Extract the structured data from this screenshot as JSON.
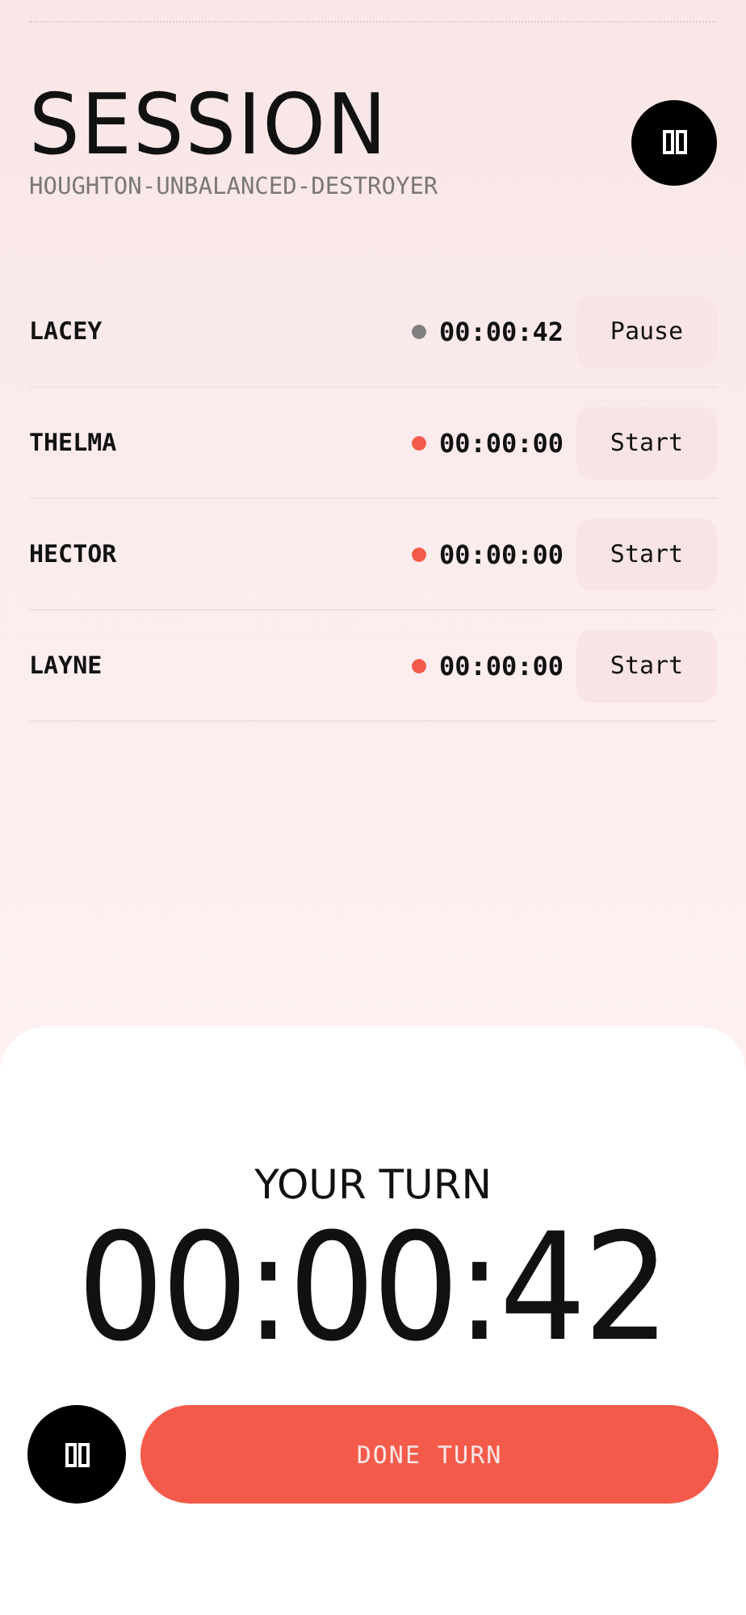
{
  "header": {
    "title": "SESSION",
    "subtitle": "HOUGHTON-UNBALANCED-DESTROYER"
  },
  "participants": [
    {
      "name": "LACEY",
      "color": "#808080",
      "time": "00:00:42",
      "action": "Pause"
    },
    {
      "name": "THELMA",
      "color": "#f45a4a",
      "time": "00:00:00",
      "action": "Start"
    },
    {
      "name": "HECTOR",
      "color": "#f45a4a",
      "time": "00:00:00",
      "action": "Start"
    },
    {
      "name": "LAYNE",
      "color": "#f45a4a",
      "time": "00:00:00",
      "action": "Start"
    }
  ],
  "turn": {
    "label": "YOUR TURN",
    "time": "00:00:42",
    "done_button": "DONE TURN"
  }
}
